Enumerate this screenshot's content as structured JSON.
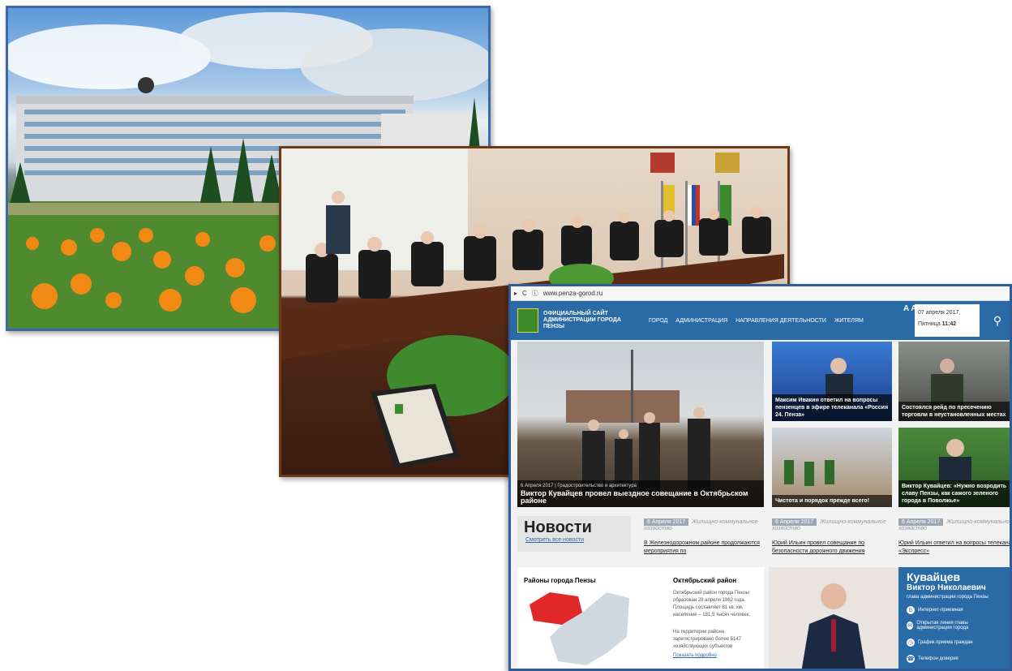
{
  "colors": {
    "site_blue": "#2a6aa6",
    "photo1_border": "#3d69a8",
    "photo2_border": "#6b3a1a",
    "screenshot_border": "#2e5d99"
  },
  "screenshot": {
    "url": "www.penza-gorod.ru",
    "site_title": "ОФИЦИАЛЬНЫЙ САЙТ АДМИНИСТРАЦИИ ГОРОДА ПЕНЗЫ",
    "nav": [
      "ГОРОД",
      "АДМИНИСТРАЦИЯ",
      "НАПРАВЛЕНИЯ ДЕЯТЕЛЬНОСТИ",
      "ЖИТЕЛЯМ"
    ],
    "font_size_toggle": "A A",
    "date": "07 апреля 2017,",
    "weekday": "Пятница",
    "time": "11:42",
    "main_story": {
      "meta": "6 Апреля 2017 | Градостроительство и архитектура",
      "title": "Виктор Кувайцев провел выездное совещание в Октябрьском районе"
    },
    "side_stories": [
      "Максим Ивакин ответил на вопросы пензенцев в эфире телеканала «Россия 24. Пенза»",
      "Состоялся рейд по пресечению торговли в неустановленных местах",
      "Чистота и порядок прежде всего!",
      "Виктор Кувайцев: «Нужно возродить славу Пензы, как самого зеленого города в Поволжье»"
    ],
    "news": {
      "heading": "Новости",
      "all_link": "Смотреть все новости",
      "items": [
        {
          "date": "6 Апреля 2017",
          "category": "Жилищно-коммунальное хозяйство",
          "title": "В Железнодорожном районе продолжаются мероприятия по"
        },
        {
          "date": "6 Апреля 2017",
          "category": "Жилищно-коммунальное хозяйство",
          "title": "Юрий Ильин провел совещание по безопасности дорожного движения"
        },
        {
          "date": "6 Апреля 2017",
          "category": "Жилищно-коммунальное хозяйство",
          "title": "Юрий Ильин ответил на вопросы телеканала «Экспресс»"
        }
      ]
    },
    "districts": {
      "title": "Районы города Пензы",
      "selected": "Октябрьский район",
      "desc1": "Октябрьский район города Пензы образован 28 апреля 1962 года. Площадь составляет 81 кв. км, население – 181,5 тысяч человек.",
      "desc2": "На территории района зарегистрировано более 5147 хозяйствующих субъектов",
      "more": "Показать подробно"
    },
    "head_of_admin": {
      "surname": "Кувайцев",
      "name": "Виктор Николаевич",
      "role": "глава администрации города Пензы",
      "links": [
        "Интернет-приемная",
        "Открытая линия главы администрации города",
        "График приема граждан",
        "Телефон доверия"
      ]
    }
  }
}
